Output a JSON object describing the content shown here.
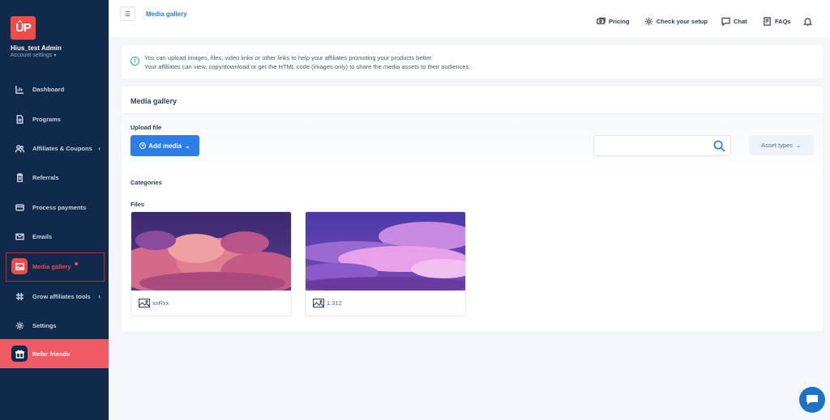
{
  "sidebar": {
    "logo_text": "ÛP",
    "account_name": "Hius_test Admin",
    "account_settings": "Account settings",
    "items": [
      {
        "label": "Dashboard",
        "icon": "chart-icon"
      },
      {
        "label": "Programs",
        "icon": "document-icon"
      },
      {
        "label": "Affiliates & Coupons",
        "icon": "users-icon",
        "has_submenu": true
      },
      {
        "label": "Referrals",
        "icon": "clipboard-icon"
      },
      {
        "label": "Process payments",
        "icon": "card-icon"
      },
      {
        "label": "Emails",
        "icon": "mail-icon"
      },
      {
        "label": "Media gallery",
        "icon": "image-icon",
        "active": true
      },
      {
        "label": "Grow affiliates tools",
        "icon": "tools-icon",
        "has_submenu": true
      },
      {
        "label": "Settings",
        "icon": "gear-icon"
      }
    ],
    "refer": {
      "label": "Refer friends",
      "icon": "gift-icon"
    }
  },
  "topbar": {
    "crumb": "Media gallery",
    "links": [
      {
        "label": "Pricing",
        "icon": "money-icon"
      },
      {
        "label": "Check your setup",
        "icon": "gear-icon"
      },
      {
        "label": "Chat",
        "icon": "chat-icon"
      },
      {
        "label": "FAQs",
        "icon": "book-icon"
      }
    ],
    "bell_icon": "bell-icon"
  },
  "info": {
    "line1": "You can upload images, files, video links or other links to help your affiliates promoting your products better.",
    "line2": "Your affiliates can view, copy/download or get the HTML code (images only) to share the media assets to their audiences."
  },
  "gallery": {
    "title": "Media gallery",
    "upload_label": "Upload file",
    "add_media": "Add media",
    "search_placeholder": "",
    "asset_types": "Asset types",
    "categories_label": "Categories",
    "files_label": "Files",
    "files": [
      {
        "name": "xxRxx",
        "type": "image-icon"
      },
      {
        "name": "1.312",
        "type": "image-icon"
      }
    ]
  },
  "colors": {
    "sidebar": "#0f2a4a",
    "accent": "#2b7de9",
    "active": "#ef4b4b"
  }
}
